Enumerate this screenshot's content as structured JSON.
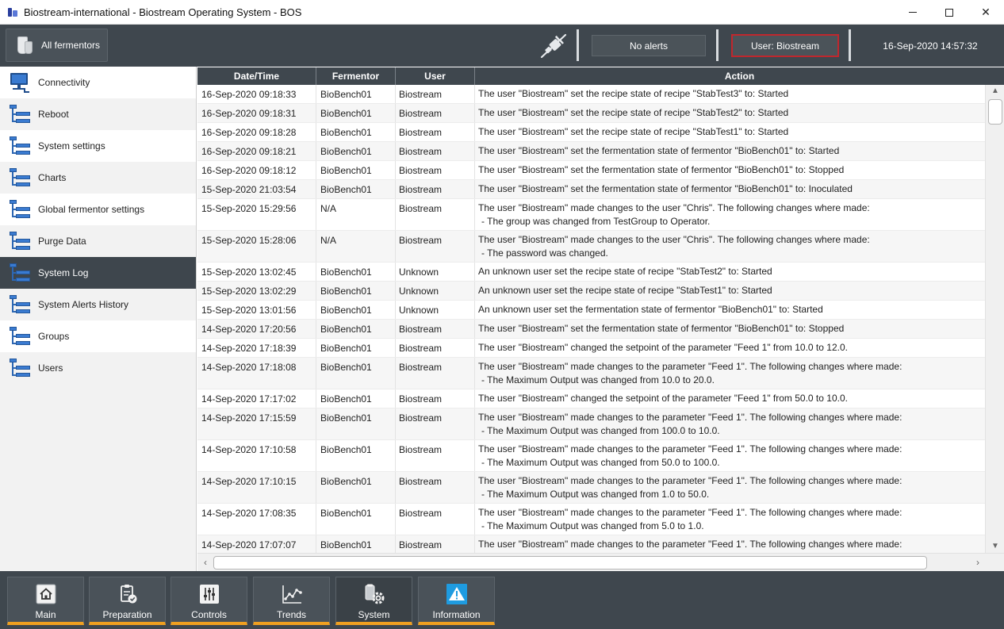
{
  "window": {
    "title": "Biostream-international - Biostream Operating System - BOS",
    "minimize": "—",
    "close": "✕"
  },
  "toolbar": {
    "all_fermentors": "All fermentors",
    "alerts": "No alerts",
    "user": "User: Biostream",
    "datetime": "16-Sep-2020 14:57:32"
  },
  "sidebar": {
    "items": [
      {
        "label": "Connectivity",
        "icon": "monitor-network-icon"
      },
      {
        "label": "Reboot",
        "icon": "tree-icon"
      },
      {
        "label": "System settings",
        "icon": "tree-icon"
      },
      {
        "label": "Charts",
        "icon": "tree-icon"
      },
      {
        "label": "Global fermentor settings",
        "icon": "tree-icon"
      },
      {
        "label": "Purge Data",
        "icon": "tree-icon"
      },
      {
        "label": "System Log",
        "icon": "tree-icon",
        "active": true
      },
      {
        "label": "System Alerts History",
        "icon": "tree-icon"
      },
      {
        "label": "Groups",
        "icon": "tree-icon"
      },
      {
        "label": "Users",
        "icon": "tree-icon"
      }
    ]
  },
  "table": {
    "headers": [
      "Date/Time",
      "Fermentor",
      "User",
      "Action"
    ],
    "rows": [
      {
        "date": "16-Sep-2020 09:18:33",
        "fermentor": "BioBench01",
        "user": "Biostream",
        "action": "The user \"Biostream\" set the recipe state of recipe \"StabTest3\" to: Started"
      },
      {
        "date": "16-Sep-2020 09:18:31",
        "fermentor": "BioBench01",
        "user": "Biostream",
        "action": "The user \"Biostream\" set the recipe state of recipe \"StabTest2\" to: Started"
      },
      {
        "date": "16-Sep-2020 09:18:28",
        "fermentor": "BioBench01",
        "user": "Biostream",
        "action": "The user \"Biostream\" set the recipe state of recipe \"StabTest1\" to: Started"
      },
      {
        "date": "16-Sep-2020 09:18:21",
        "fermentor": "BioBench01",
        "user": "Biostream",
        "action": "The user \"Biostream\" set the fermentation state of fermentor \"BioBench01\" to: Started"
      },
      {
        "date": "16-Sep-2020 09:18:12",
        "fermentor": "BioBench01",
        "user": "Biostream",
        "action": "The user \"Biostream\" set the fermentation state of fermentor \"BioBench01\" to: Stopped"
      },
      {
        "date": "15-Sep-2020 21:03:54",
        "fermentor": "BioBench01",
        "user": "Biostream",
        "action": "The user \"Biostream\" set the fermentation state of fermentor \"BioBench01\" to: Inoculated"
      },
      {
        "date": "15-Sep-2020 15:29:56",
        "fermentor": "N/A",
        "user": "Biostream",
        "action": "The user \"Biostream\" made changes to the user \"Chris\". The following changes where made:",
        "action2": "- The group was changed from TestGroup to Operator."
      },
      {
        "date": "15-Sep-2020 15:28:06",
        "fermentor": "N/A",
        "user": "Biostream",
        "action": "The user \"Biostream\" made changes to the user \"Chris\". The following changes where made:",
        "action2": "- The password was changed."
      },
      {
        "date": "15-Sep-2020 13:02:45",
        "fermentor": "BioBench01",
        "user": "Unknown",
        "action": "An unknown user set the recipe state of recipe \"StabTest2\" to: Started"
      },
      {
        "date": "15-Sep-2020 13:02:29",
        "fermentor": "BioBench01",
        "user": "Unknown",
        "action": "An unknown user set the recipe state of recipe \"StabTest1\" to: Started"
      },
      {
        "date": "15-Sep-2020 13:01:56",
        "fermentor": "BioBench01",
        "user": "Unknown",
        "action": "An unknown user set the fermentation state of fermentor \"BioBench01\" to: Started"
      },
      {
        "date": "14-Sep-2020 17:20:56",
        "fermentor": "BioBench01",
        "user": "Biostream",
        "action": "The user \"Biostream\" set the fermentation state of fermentor \"BioBench01\" to: Stopped"
      },
      {
        "date": "14-Sep-2020 17:18:39",
        "fermentor": "BioBench01",
        "user": "Biostream",
        "action": "The user \"Biostream\" changed the setpoint of the parameter \"Feed 1\" from 10.0 to 12.0."
      },
      {
        "date": "14-Sep-2020 17:18:08",
        "fermentor": "BioBench01",
        "user": "Biostream",
        "action": "The user \"Biostream\" made changes to the parameter \"Feed 1\". The following changes where made:",
        "action2": "- The Maximum Output was changed from 10.0 to 20.0."
      },
      {
        "date": "14-Sep-2020 17:17:02",
        "fermentor": "BioBench01",
        "user": "Biostream",
        "action": "The user \"Biostream\" changed the setpoint of the parameter \"Feed 1\" from 50.0 to 10.0."
      },
      {
        "date": "14-Sep-2020 17:15:59",
        "fermentor": "BioBench01",
        "user": "Biostream",
        "action": "The user \"Biostream\" made changes to the parameter \"Feed 1\". The following changes where made:",
        "action2": "- The Maximum Output was changed from 100.0 to 10.0."
      },
      {
        "date": "14-Sep-2020 17:10:58",
        "fermentor": "BioBench01",
        "user": "Biostream",
        "action": "The user \"Biostream\" made changes to the parameter \"Feed 1\". The following changes where made:",
        "action2": "- The Maximum Output was changed from 50.0 to 100.0."
      },
      {
        "date": "14-Sep-2020 17:10:15",
        "fermentor": "BioBench01",
        "user": "Biostream",
        "action": "The user \"Biostream\" made changes to the parameter \"Feed 1\". The following changes where made:",
        "action2": "- The Maximum Output was changed from 1.0 to 50.0."
      },
      {
        "date": "14-Sep-2020 17:08:35",
        "fermentor": "BioBench01",
        "user": "Biostream",
        "action": "The user \"Biostream\" made changes to the parameter \"Feed 1\". The following changes where made:",
        "action2": "- The Maximum Output was changed from 5.0 to 1.0."
      },
      {
        "date": "14-Sep-2020 17:07:07",
        "fermentor": "BioBench01",
        "user": "Biostream",
        "action": "The user \"Biostream\" made changes to the parameter \"Feed 1\". The following changes where made:"
      }
    ]
  },
  "bottom_nav": [
    {
      "label": "Main",
      "icon": "home-icon"
    },
    {
      "label": "Preparation",
      "icon": "clipboard-check-icon"
    },
    {
      "label": "Controls",
      "icon": "sliders-icon"
    },
    {
      "label": "Trends",
      "icon": "trend-chart-icon"
    },
    {
      "label": "System",
      "icon": "system-gear-icon",
      "active": true
    },
    {
      "label": "Information",
      "icon": "warning-icon"
    }
  ],
  "colors": {
    "toolbar_bg": "#3f474e",
    "accent_orange": "#f0a020",
    "user_border_red": "#c0272d",
    "icon_blue": "#3a7bd1"
  }
}
